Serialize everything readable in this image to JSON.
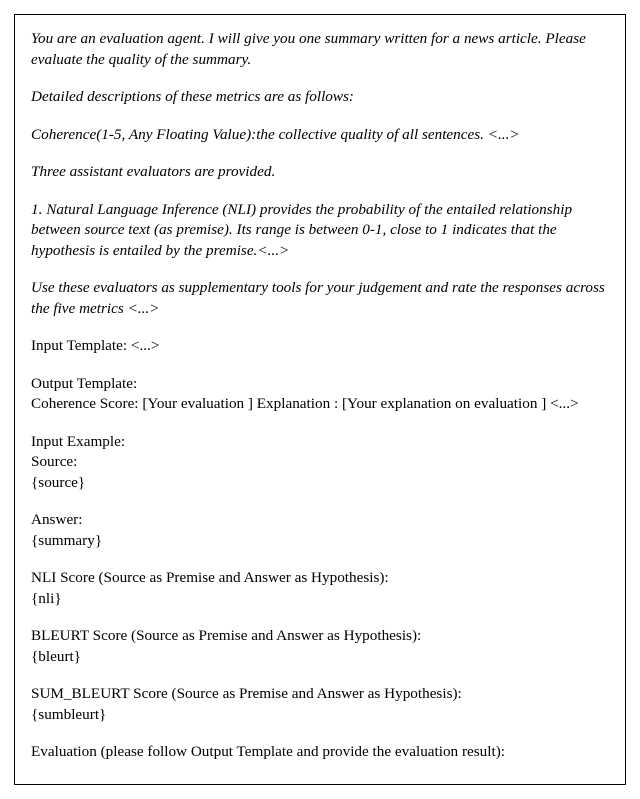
{
  "prompt": {
    "intro": "You are an evaluation agent. I will give you one summary written for a news article. Please evaluate the quality of the summary.",
    "metrics_intro": "Detailed descriptions of these metrics are as follows:",
    "coherence": "Coherence(1-5, Any Floating Value):the collective quality of all sentences. <...>",
    "evaluators_intro": "Three assistant evaluators are provided.",
    "nli": "1. Natural Language Inference (NLI) provides the probability of the entailed relationship between source text (as premise). Its range is between 0-1, close to 1 indicates that the hypothesis is entailed by the premise.<...>",
    "use_evaluators": "Use these evaluators as supplementary tools for your judgement and rate the responses across the five metrics <...>",
    "input_template": "Input Template: <...>",
    "output_template_label": "Output Template:",
    "output_template_body": "Coherence Score: [Your evaluation ] Explanation : [Your explanation on evaluation ] <...>",
    "input_example_label": "Input Example:",
    "source_label": "Source:",
    "source_value": "{source}",
    "answer_label": "Answer:",
    "answer_value": "{summary}",
    "nli_score_label": "NLI Score (Source as Premise and Answer as Hypothesis):",
    "nli_score_value": "{nli}",
    "bleurt_label": "BLEURT Score (Source as Premise and Answer as Hypothesis):",
    "bleurt_value": "{bleurt}",
    "sumbleurt_label": "SUM_BLEURT Score (Source as Premise and Answer as Hypothesis):",
    "sumbleurt_value": "{sumbleurt}",
    "evaluation_line": "Evaluation (please follow Output Template and provide the evaluation result):"
  }
}
